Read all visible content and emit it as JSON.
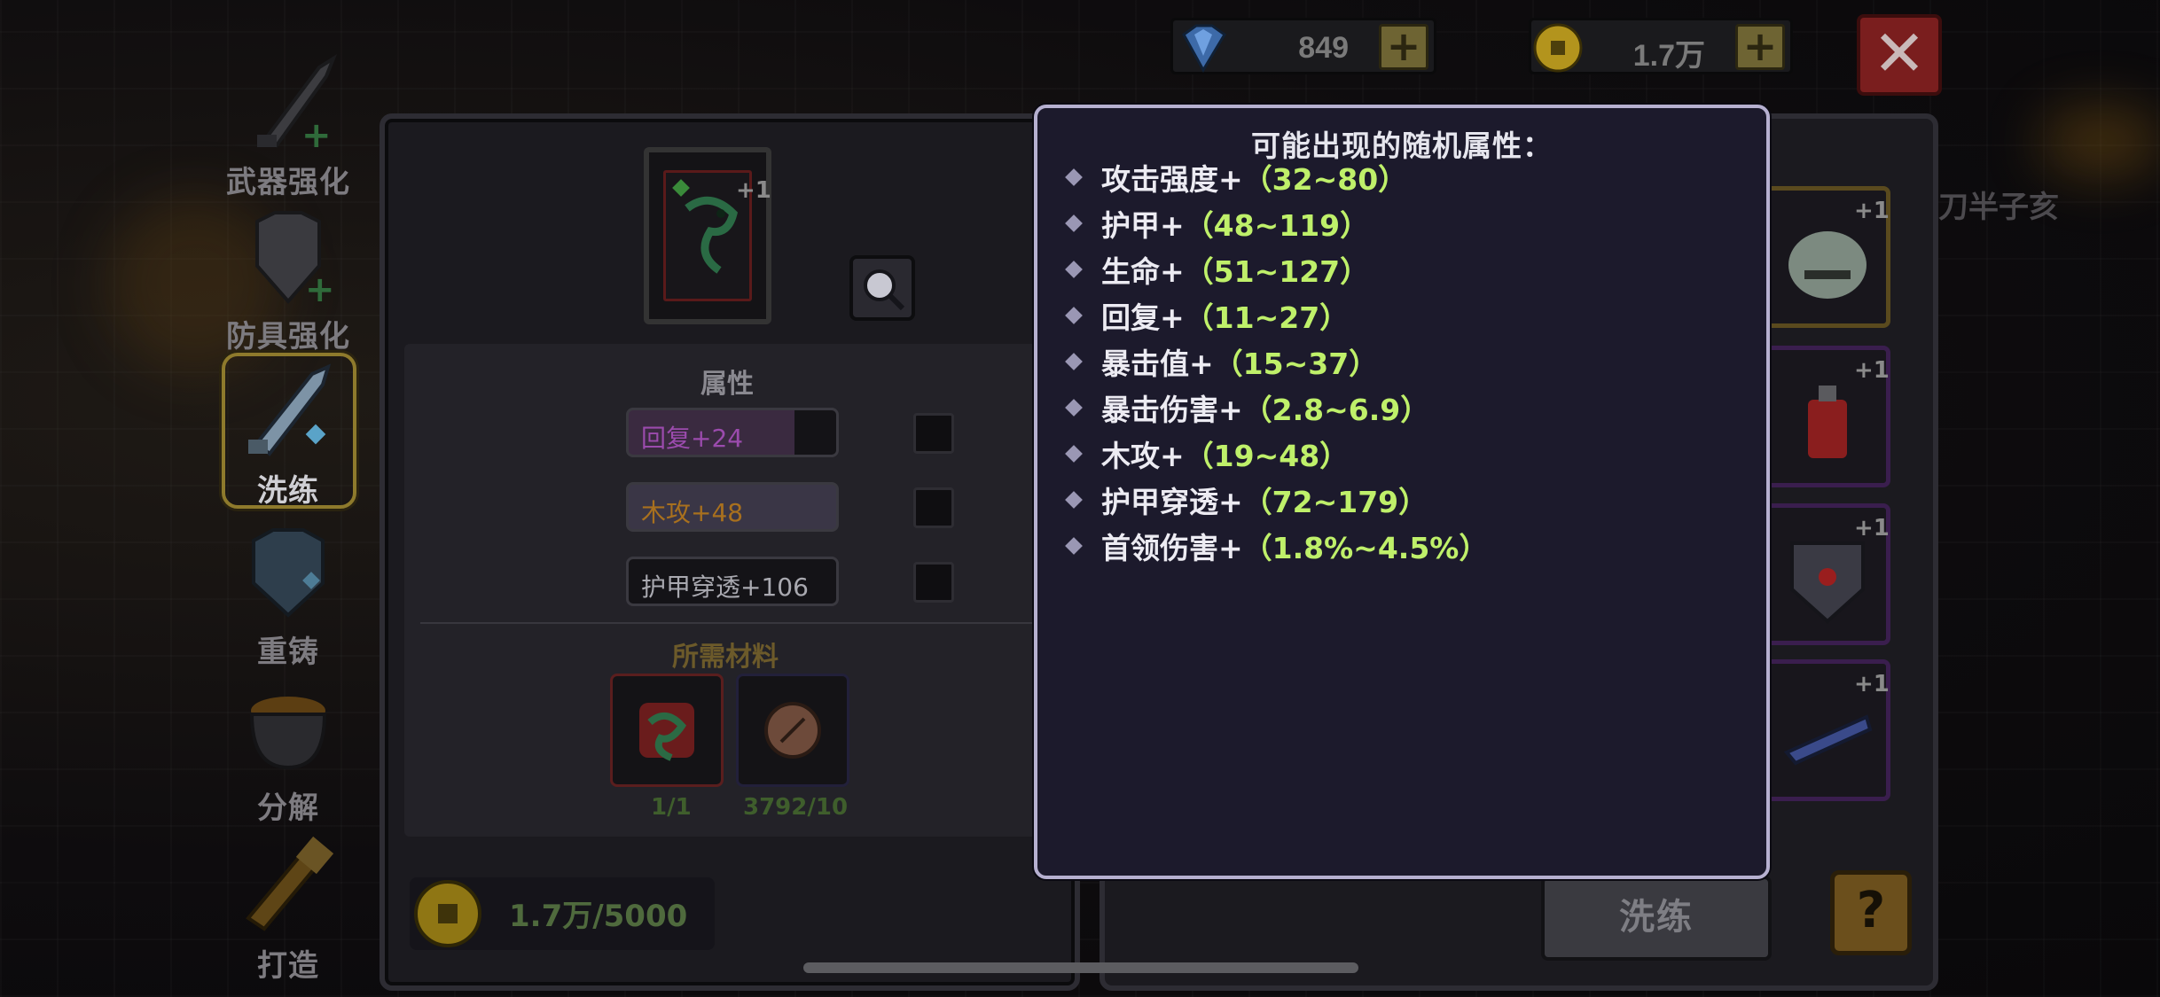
{
  "currency": {
    "gems": "849",
    "gold": "1.7万",
    "gem_plus": "+",
    "gold_plus": "+",
    "close": "✕"
  },
  "sidebar": {
    "items": [
      {
        "label": "武器强化",
        "icon": "sword-upgrade-icon"
      },
      {
        "label": "防具强化",
        "icon": "armor-upgrade-icon"
      },
      {
        "label": "洗练",
        "icon": "reforge-sword-icon"
      },
      {
        "label": "重铸",
        "icon": "recast-armor-icon"
      },
      {
        "label": "分解",
        "icon": "cauldron-icon"
      },
      {
        "label": "打造",
        "icon": "forge-hammer-icon"
      }
    ]
  },
  "item": {
    "level": "+1"
  },
  "attributes": {
    "title": "属性",
    "rows": [
      {
        "text": "回复+24",
        "color": "#a04ab3"
      },
      {
        "text": "木攻+48",
        "color": "#b0741e"
      },
      {
        "text": "护甲穿透+106",
        "color": "#b9b9bf"
      }
    ]
  },
  "materials": {
    "title": "所需材料",
    "items": [
      {
        "count": "1/1",
        "icon": "snake-material-icon"
      },
      {
        "count": "3792/10",
        "icon": "stone-material-icon"
      }
    ]
  },
  "cost": {
    "text": "1.7万/5000"
  },
  "right_panel": {
    "npc_label": "刀半子亥",
    "slots": [
      {
        "level": "+1",
        "icon": "dino-skull-icon"
      },
      {
        "level": "+1",
        "icon": "red-potion-icon"
      },
      {
        "level": "+1",
        "icon": "shield-icon"
      },
      {
        "level": "+1",
        "icon": "blaster-icon"
      }
    ],
    "wash_button": "洗练",
    "help_button": "?"
  },
  "popup": {
    "title": "可能出现的随机属性：",
    "props": [
      {
        "name": "攻击强度+",
        "range": "（32~80）"
      },
      {
        "name": "护甲+",
        "range": "（48~119）"
      },
      {
        "name": "生命+",
        "range": "（51~127）"
      },
      {
        "name": "回复+",
        "range": "（11~27）"
      },
      {
        "name": "暴击值+",
        "range": "（15~37）"
      },
      {
        "name": "暴击伤害+",
        "range": "（2.8~6.9）"
      },
      {
        "name": "木攻+",
        "range": "（19~48）"
      },
      {
        "name": "护甲穿透+",
        "range": "（72~179）"
      },
      {
        "name": "首领伤害+",
        "range": "（1.8%~4.5%）"
      }
    ]
  },
  "colors": {
    "accent_green": "#bff06a",
    "popup_border": "#b6b0d0",
    "close_red": "#7a1e1e"
  }
}
